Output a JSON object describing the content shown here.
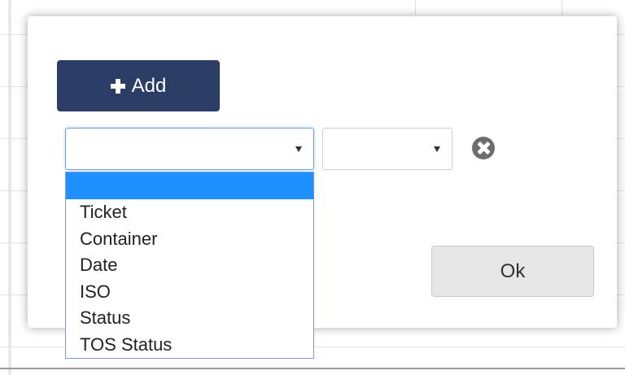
{
  "modal": {
    "add_button": {
      "label": "Add",
      "icon": "plus-icon"
    },
    "field_select": {
      "value": ""
    },
    "operator_select": {
      "value": ""
    },
    "remove_icon": "remove-circle-icon",
    "ok_button": {
      "label": "Ok"
    }
  },
  "dropdown": {
    "options": [
      "",
      "Ticket",
      "Container",
      "Date",
      "ISO",
      "Status",
      "TOS Status"
    ],
    "selected_index": 0
  },
  "colors": {
    "primary_button": "#2b3c66",
    "selected_option": "#1e90ff",
    "focus_border": "#6f9ee0"
  }
}
